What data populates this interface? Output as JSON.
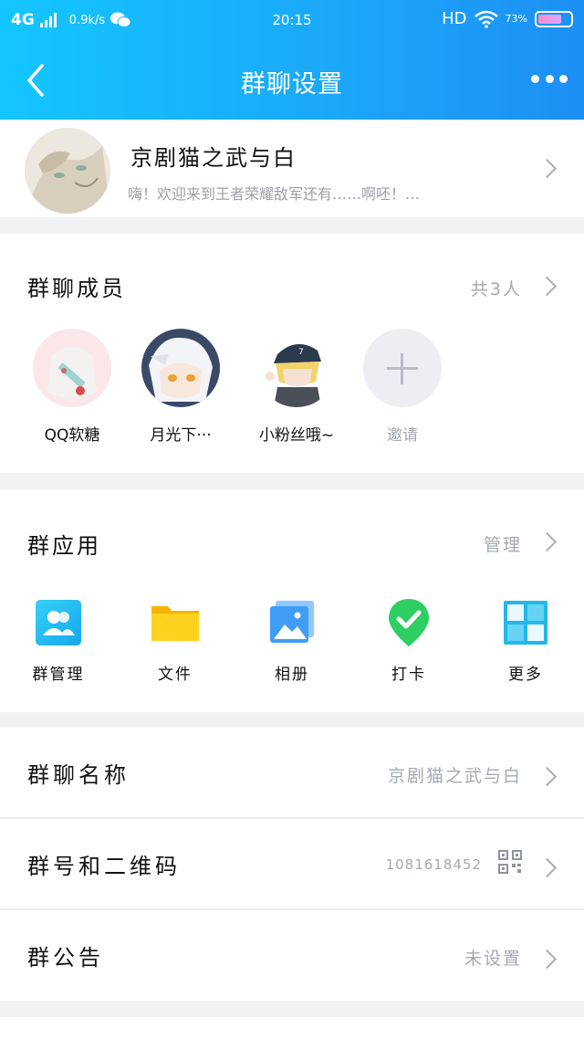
{
  "status_bar": {
    "network": "4G",
    "speed": "0.9k/s",
    "time": "20:15",
    "hd": "HD",
    "battery": "73%",
    "battery_level": 0.73
  },
  "nav": {
    "title": "群聊设置"
  },
  "group": {
    "name": "京剧猫之武与白",
    "intro": "嗨！欢迎来到王者荣耀敌军还有……啊呸！…"
  },
  "members": {
    "title": "群聊成员",
    "count_label": "共3人",
    "list": [
      {
        "name": "QQ软糖"
      },
      {
        "name": "月光下···"
      },
      {
        "name": "小粉丝哦~"
      }
    ],
    "invite_label": "邀请"
  },
  "apps": {
    "title": "群应用",
    "manage_label": "管理",
    "items": [
      {
        "label": "群管理",
        "icon": "group-manage-icon"
      },
      {
        "label": "文件",
        "icon": "folder-icon"
      },
      {
        "label": "相册",
        "icon": "album-icon"
      },
      {
        "label": "打卡",
        "icon": "check-in-icon"
      },
      {
        "label": "更多",
        "icon": "more-grid-icon"
      }
    ]
  },
  "settings": {
    "group_name_label": "群聊名称",
    "group_name_value": "京剧猫之武与白",
    "group_number_label": "群号和二维码",
    "group_number_value": "1081618452",
    "announcement_label": "群公告",
    "announcement_value": "未设置"
  },
  "colors": {
    "header_start": "#13c6ff",
    "header_end": "#1d8ff5",
    "muted_text": "#a3a8b2"
  }
}
